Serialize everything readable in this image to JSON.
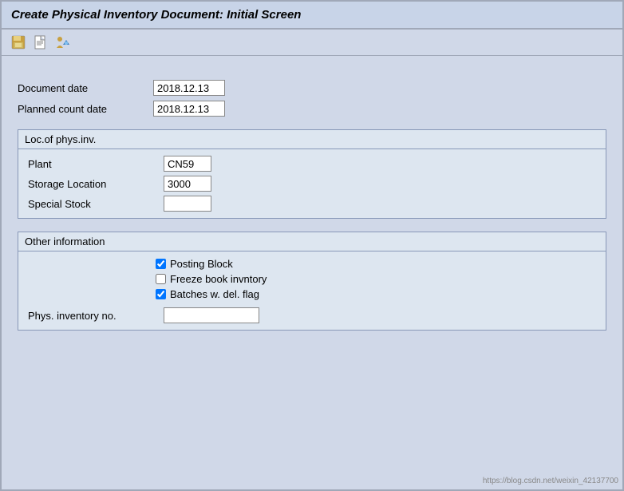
{
  "title": "Create Physical Inventory Document: Initial Screen",
  "toolbar": {
    "icons": [
      "save-icon",
      "new-icon",
      "customize-icon"
    ]
  },
  "dates": {
    "document_date_label": "Document date",
    "document_date_value": "2018.12.13",
    "planned_count_date_label": "Planned count date",
    "planned_count_date_value": "2018.12.13"
  },
  "loc_group": {
    "header": "Loc.of phys.inv.",
    "plant_label": "Plant",
    "plant_value": "CN59",
    "storage_location_label": "Storage Location",
    "storage_location_value": "3000",
    "special_stock_label": "Special Stock",
    "special_stock_value": ""
  },
  "other_info": {
    "header": "Other information",
    "posting_block_label": "Posting Block",
    "posting_block_checked": true,
    "freeze_book_label": "Freeze book invntory",
    "freeze_book_checked": false,
    "batches_del_label": "Batches w. del. flag",
    "batches_del_checked": true,
    "phys_inv_no_label": "Phys. inventory no.",
    "phys_inv_no_value": ""
  },
  "watermark": "https://blog.csdn.net/weixin_42137700"
}
